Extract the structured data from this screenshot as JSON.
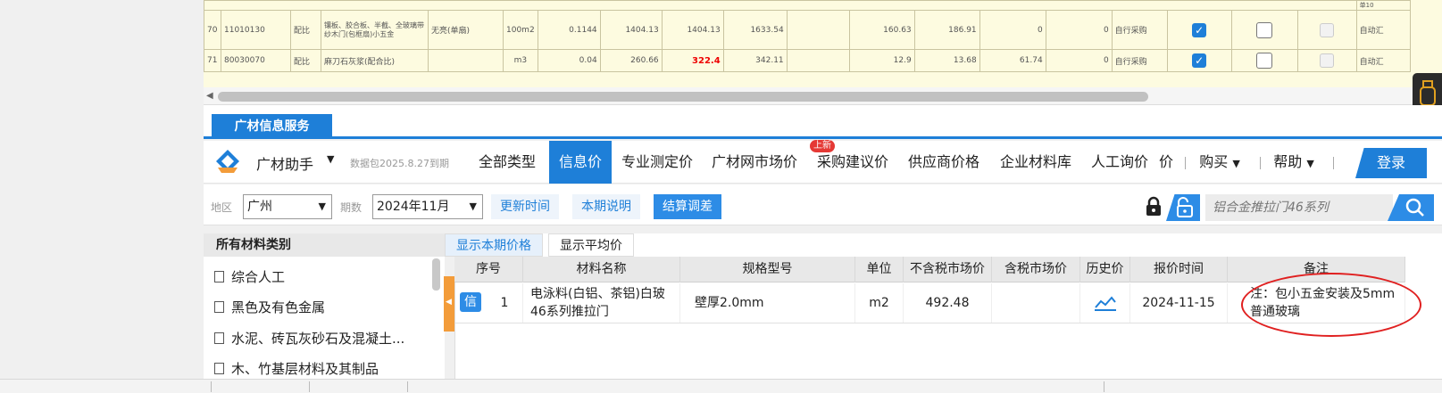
{
  "top_grid": {
    "header_fragment": "单10",
    "rows": [
      {
        "no": "70",
        "code": "11010130",
        "type": "配比",
        "name": "镶板、胶合板、半截、全玻璃带纱木门(包框扇)小五金",
        "spec": "无亮(单扇)",
        "unit": "100m2",
        "qty": "0.1144",
        "p1": "1404.13",
        "p2": "1404.13",
        "p3": "1633.54",
        "p4": "",
        "p5": "160.63",
        "p6": "186.91",
        "p7": "0",
        "p8": "0",
        "source": "自行采购",
        "check1": true,
        "check2": false,
        "tail": "自动汇"
      },
      {
        "no": "71",
        "code": "80030070",
        "type": "配比",
        "name": "麻刀石灰浆(配合比)",
        "spec": "",
        "unit": "m3",
        "qty": "0.04",
        "p1": "260.66",
        "p2": "322.4",
        "p3": "342.11",
        "p4": "",
        "p5": "12.9",
        "p6": "13.68",
        "p7": "61.74",
        "p8": "0",
        "source": "自行采购",
        "check1": true,
        "check2": false,
        "tail": "自动汇"
      }
    ]
  },
  "panel": {
    "tab_label": "广材信息服务",
    "assistant_label": "广材助手",
    "package_info": "数据包2025.8.27到期",
    "nav_tabs": [
      "全部类型",
      "信息价",
      "专业测定价",
      "广材网市场价",
      "采购建议价",
      "供应商价格",
      "企业材料库",
      "人工询价",
      "价"
    ],
    "active_tab": "信息价",
    "new_badge": "上新",
    "buy_label": "购买",
    "help_label": "帮助",
    "login_label": "登录"
  },
  "filters": {
    "region_label": "地区",
    "region_value": "广州",
    "period_label": "期数",
    "period_value": "2024年11月",
    "update_time": "更新时间",
    "period_note": "本期说明",
    "settle_adjust": "结算调差",
    "search_placeholder": "铝合金推拉门46系列"
  },
  "categories": {
    "title": "所有材料类别",
    "items": [
      "综合人工",
      "黑色及有色金属",
      "水泥、砖瓦灰砂石及混凝土...",
      "木、竹基层材料及其制品"
    ]
  },
  "results": {
    "tab_current": "显示本期价格",
    "tab_avg": "显示平均价",
    "headers": [
      "序号",
      "材料名称",
      "规格型号",
      "单位",
      "不含税市场价",
      "含税市场价",
      "历史价",
      "报价时间",
      "备注"
    ],
    "rows": [
      {
        "badge": "信",
        "no": "1",
        "name": "电泳料(白铝、茶铝)白玻46系列推拉门",
        "spec": "壁厚2.0mm",
        "unit": "m2",
        "price_ex_tax": "492.48",
        "price_tax": "",
        "history_icon": "trend-chart-icon",
        "date": "2024-11-15",
        "remark": "注：包小五金安装及5mm普通玻璃"
      }
    ]
  },
  "colors": {
    "accent": "#1e7fd8",
    "annotation": "#e02020",
    "grid_bg": "#fdfbe0",
    "handle": "#f39c3a"
  }
}
